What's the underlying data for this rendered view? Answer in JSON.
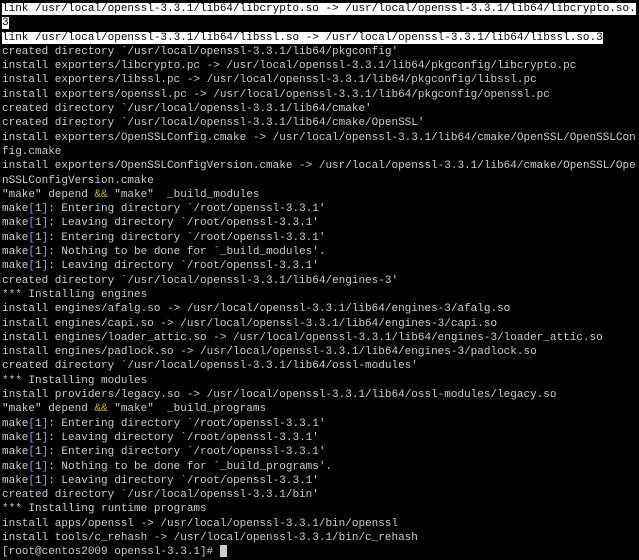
{
  "lines": [
    {
      "cls": "hl",
      "t": "link /usr/local/openssl-3.3.1/lib64/libcrypto.so -> /usr/local/openssl-3.3.1/lib64/libcrypto.so.3"
    },
    {
      "cls": "hl",
      "t": "link /usr/local/openssl-3.3.1/lib64/libssl.so -> /usr/local/openssl-3.3.1/lib64/libssl.so.3"
    },
    {
      "t": "created directory `/usr/local/openssl-3.3.1/lib64/pkgconfig'"
    },
    {
      "t": "install exporters/libcrypto.pc -> /usr/local/openssl-3.3.1/lib64/pkgconfig/libcrypto.pc"
    },
    {
      "t": "install exporters/libssl.pc -> /usr/local/openssl-3.3.1/lib64/pkgconfig/libssl.pc"
    },
    {
      "t": "install exporters/openssl.pc -> /usr/local/openssl-3.3.1/lib64/pkgconfig/openssl.pc"
    },
    {
      "t": "created directory `/usr/local/openssl-3.3.1/lib64/cmake'"
    },
    {
      "t": "created directory `/usr/local/openssl-3.3.1/lib64/cmake/OpenSSL'"
    },
    {
      "t": "install exporters/OpenSSLConfig.cmake -> /usr/local/openssl-3.3.1/lib64/cmake/OpenSSL/OpenSSLConfig.cmake"
    },
    {
      "t": "install exporters/OpenSSLConfigVersion.cmake -> /usr/local/openssl-3.3.1/lib64/cmake/OpenSSL/OpenSSLConfigVersion.cmake"
    },
    {
      "type": "make",
      "p": [
        "\"make\" depend ",
        " \"make\"  _build_modules"
      ]
    },
    {
      "type": "makeline",
      "n": "1",
      "t": ": Entering directory `/root/openssl-3.3.1'"
    },
    {
      "type": "makeline",
      "n": "1",
      "t": ": Leaving directory `/root/openssl-3.3.1'"
    },
    {
      "type": "makeline",
      "n": "1",
      "t": ": Entering directory `/root/openssl-3.3.1'"
    },
    {
      "type": "makeline",
      "n": "1",
      "t": ": Nothing to be done for `_build_modules'."
    },
    {
      "type": "makeline",
      "n": "1",
      "t": ": Leaving directory `/root/openssl-3.3.1'"
    },
    {
      "t": "created directory `/usr/local/openssl-3.3.1/lib64/engines-3'"
    },
    {
      "t": "*** Installing engines"
    },
    {
      "t": "install engines/afalg.so -> /usr/local/openssl-3.3.1/lib64/engines-3/afalg.so"
    },
    {
      "t": "install engines/capi.so -> /usr/local/openssl-3.3.1/lib64/engines-3/capi.so"
    },
    {
      "t": "install engines/loader_attic.so -> /usr/local/openssl-3.3.1/lib64/engines-3/loader_attic.so"
    },
    {
      "t": "install engines/padlock.so -> /usr/local/openssl-3.3.1/lib64/engines-3/padlock.so"
    },
    {
      "t": "created directory `/usr/local/openssl-3.3.1/lib64/ossl-modules'"
    },
    {
      "t": "*** Installing modules"
    },
    {
      "t": "install providers/legacy.so -> /usr/local/openssl-3.3.1/lib64/ossl-modules/legacy.so"
    },
    {
      "type": "make",
      "p": [
        "\"make\" depend ",
        " \"make\"  _build_programs"
      ]
    },
    {
      "type": "makeline",
      "n": "1",
      "t": ": Entering directory `/root/openssl-3.3.1'"
    },
    {
      "type": "makeline",
      "n": "1",
      "t": ": Leaving directory `/root/openssl-3.3.1'"
    },
    {
      "type": "makeline",
      "n": "1",
      "t": ": Entering directory `/root/openssl-3.3.1'"
    },
    {
      "type": "makeline",
      "n": "1",
      "t": ": Nothing to be done for `_build_programs'."
    },
    {
      "type": "makeline",
      "n": "1",
      "t": ": Leaving directory `/root/openssl-3.3.1'"
    },
    {
      "t": "created directory `/usr/local/openssl-3.3.1/bin'"
    },
    {
      "t": "*** Installing runtime programs"
    },
    {
      "t": "install apps/openssl -> /usr/local/openssl-3.3.1/bin/openssl"
    },
    {
      "t": "install tools/c_rehash -> /usr/local/openssl-3.3.1/bin/c_rehash"
    }
  ],
  "prompt": "[root@centos2009 openssl-3.3.1]# "
}
